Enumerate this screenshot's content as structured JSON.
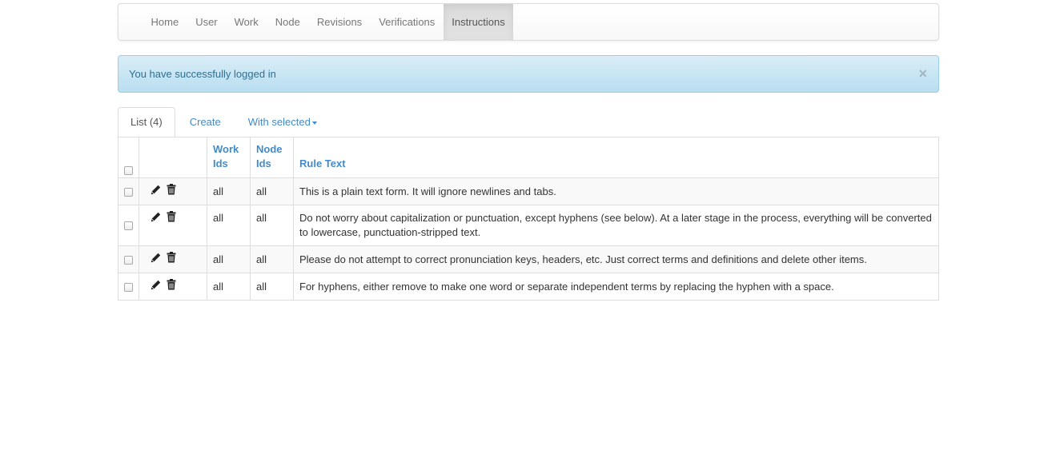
{
  "navbar": {
    "items": [
      {
        "label": "Home",
        "active": false
      },
      {
        "label": "User",
        "active": false
      },
      {
        "label": "Work",
        "active": false
      },
      {
        "label": "Node",
        "active": false
      },
      {
        "label": "Revisions",
        "active": false
      },
      {
        "label": "Verifications",
        "active": false
      },
      {
        "label": "Instructions",
        "active": true
      }
    ]
  },
  "alert": {
    "message": "You have successfully logged in",
    "close_label": "×"
  },
  "tabs": {
    "list_label": "List (4)",
    "create_label": "Create",
    "with_selected_label": "With selected"
  },
  "table": {
    "headers": {
      "work_ids": [
        "Work",
        "Ids"
      ],
      "node_ids": [
        "Node",
        "Ids"
      ],
      "rule_text": "Rule Text"
    },
    "rows": [
      {
        "work_ids": "all",
        "node_ids": "all",
        "rule_text": "This is a plain text form. It will ignore newlines and tabs."
      },
      {
        "work_ids": "all",
        "node_ids": "all",
        "rule_text": "Do not worry about capitalization or punctuation, except hyphens (see below). At a later stage in the process, everything will be converted to lowercase, punctuation-stripped text."
      },
      {
        "work_ids": "all",
        "node_ids": "all",
        "rule_text": "Please do not attempt to correct pronunciation keys, headers, etc. Just correct terms and definitions and delete other items."
      },
      {
        "work_ids": "all",
        "node_ids": "all",
        "rule_text": "For hyphens, either remove to make one word or separate independent terms by replacing the hyphen with a space."
      }
    ]
  },
  "icons": {
    "edit": "pencil-icon",
    "delete": "trash-icon"
  },
  "colors": {
    "link": "#428bca",
    "alert_text": "#31708f",
    "alert_bg": "#d9edf7",
    "active_nav_bg": "#dbdbdb"
  }
}
